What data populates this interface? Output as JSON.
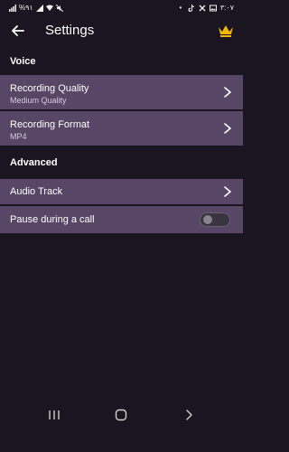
{
  "status_bar": {
    "left_text": "%٩١",
    "time": "٣:٠٧",
    "icons_left": [
      "signal-icon",
      "wifi-icon",
      "mute-icon"
    ],
    "icons_right": [
      "dot-icon",
      "tiktok-icon",
      "app-icon",
      "image-icon"
    ]
  },
  "header": {
    "title": "Settings",
    "back_icon": "arrow-left-icon",
    "premium_icon": "crown-icon",
    "accent": "#f2b705"
  },
  "sections": {
    "voice": {
      "title": "Voice",
      "recording_quality": {
        "label": "Recording Quality",
        "value": "Medium Quality"
      },
      "recording_format": {
        "label": "Recording Format",
        "value": "MP4"
      }
    },
    "advanced": {
      "title": "Advanced",
      "audio_track": {
        "label": "Audio Track"
      },
      "pause_during_call": {
        "label": "Pause during a call",
        "enabled": false
      }
    }
  },
  "colors": {
    "background": "#1a1520",
    "row_background": "#574666",
    "subtext": "#d6cbe0"
  },
  "nav": {
    "recents_icon": "recents-icon",
    "home_icon": "home-icon",
    "back_icon": "nav-back-icon"
  }
}
